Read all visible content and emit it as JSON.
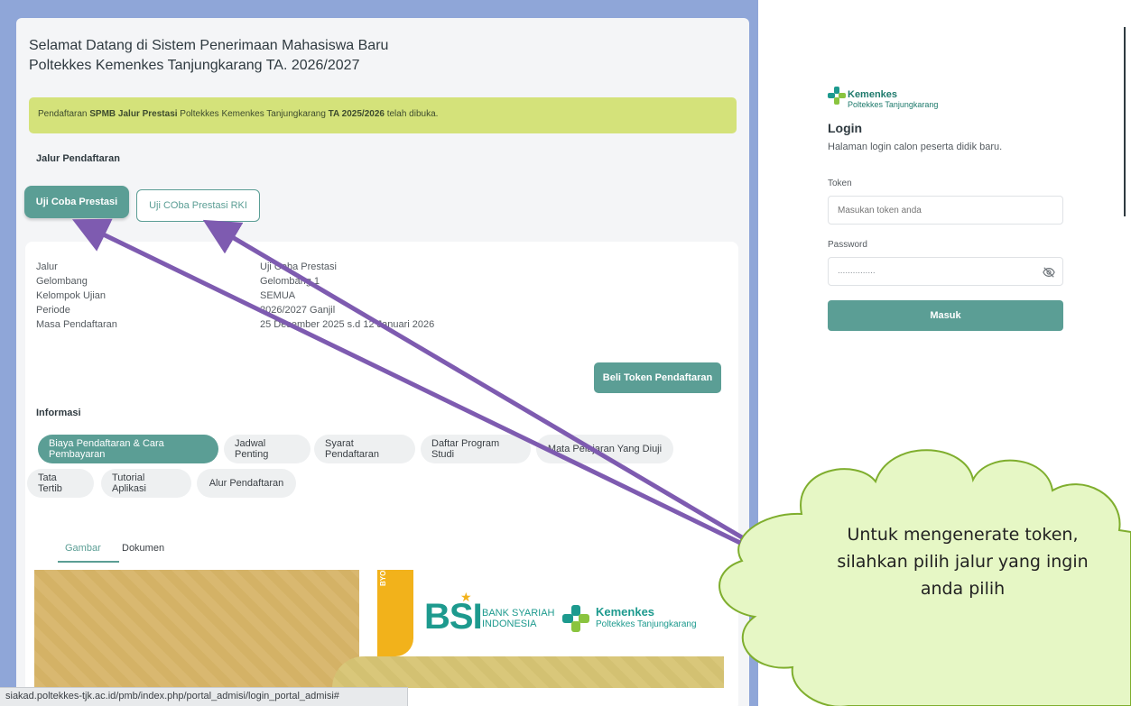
{
  "header": {
    "title_line1": "Selamat Datang di Sistem Penerimaan Mahasiswa Baru",
    "title_line2": "Poltekkes Kemenkes Tanjungkarang TA. 2026/2027"
  },
  "banner": {
    "pre": "Pendaftaran ",
    "bold1": "SPMB Jalur Prestasi",
    "mid": " Poltekkes Kemenkes Tanjungkarang ",
    "bold2": "TA 2025/2026",
    "post": " telah dibuka."
  },
  "jalur": {
    "label": "Jalur Pendaftaran",
    "tabs": [
      "Uji Coba Prestasi",
      "Uji COba Prestasi RKI"
    ]
  },
  "details": [
    {
      "key": "Jalur",
      "value": "Uji Coba Prestasi"
    },
    {
      "key": "Gelombang",
      "value": "Gelombang 1"
    },
    {
      "key": "Kelompok Ujian",
      "value": "SEMUA"
    },
    {
      "key": "Periode",
      "value": "2026/2027 Ganjil"
    },
    {
      "key": "Masa Pendaftaran",
      "value": "25 Desember 2025 s.d 12 Januari 2026"
    }
  ],
  "beli_button": "Beli Token Pendaftaran",
  "informasi": {
    "label": "Informasi",
    "pills_row1": [
      "Biaya Pendaftaran & Cara Pembayaran",
      "Jadwal Penting",
      "Syarat Pendaftaran",
      "Daftar Program Studi",
      "Mata Pelajaran Yang Diuji"
    ],
    "pills_row2": [
      "Tata Tertib",
      "Tutorial Aplikasi",
      "Alur Pendaftaran"
    ],
    "subtabs": [
      "Gambar",
      "Dokumen"
    ]
  },
  "promo": {
    "byond": "BYOND",
    "bsi": "BSI",
    "bsi_sub1": "BANK SYARIAH",
    "bsi_sub2": "INDONESIA",
    "kemenkes": "Kemenkes",
    "kemenkes_sub": "Poltekkes Tanjungkarang"
  },
  "status_url": "siakad.poltekkes-tjk.ac.id/pmb/index.php/portal_admisi/login_portal_admisi#",
  "login": {
    "logo_name": "Kemenkes",
    "logo_sub": "Poltekkes Tanjungkarang",
    "title": "Login",
    "subtitle": "Halaman login calon peserta didik baru.",
    "token_label": "Token",
    "token_placeholder": "Masukan token anda",
    "password_label": "Password",
    "password_value": "...............",
    "submit": "Masuk"
  },
  "annotation": {
    "line1": "Untuk mengenerate token,",
    "line2": "silahkan pilih jalur yang ingin",
    "line3": "anda pilih"
  },
  "colors": {
    "teal": "#5b9e95",
    "banner": "#d4e27a",
    "arrow": "#7e5bb0",
    "cloud": "#e6f7c5"
  }
}
